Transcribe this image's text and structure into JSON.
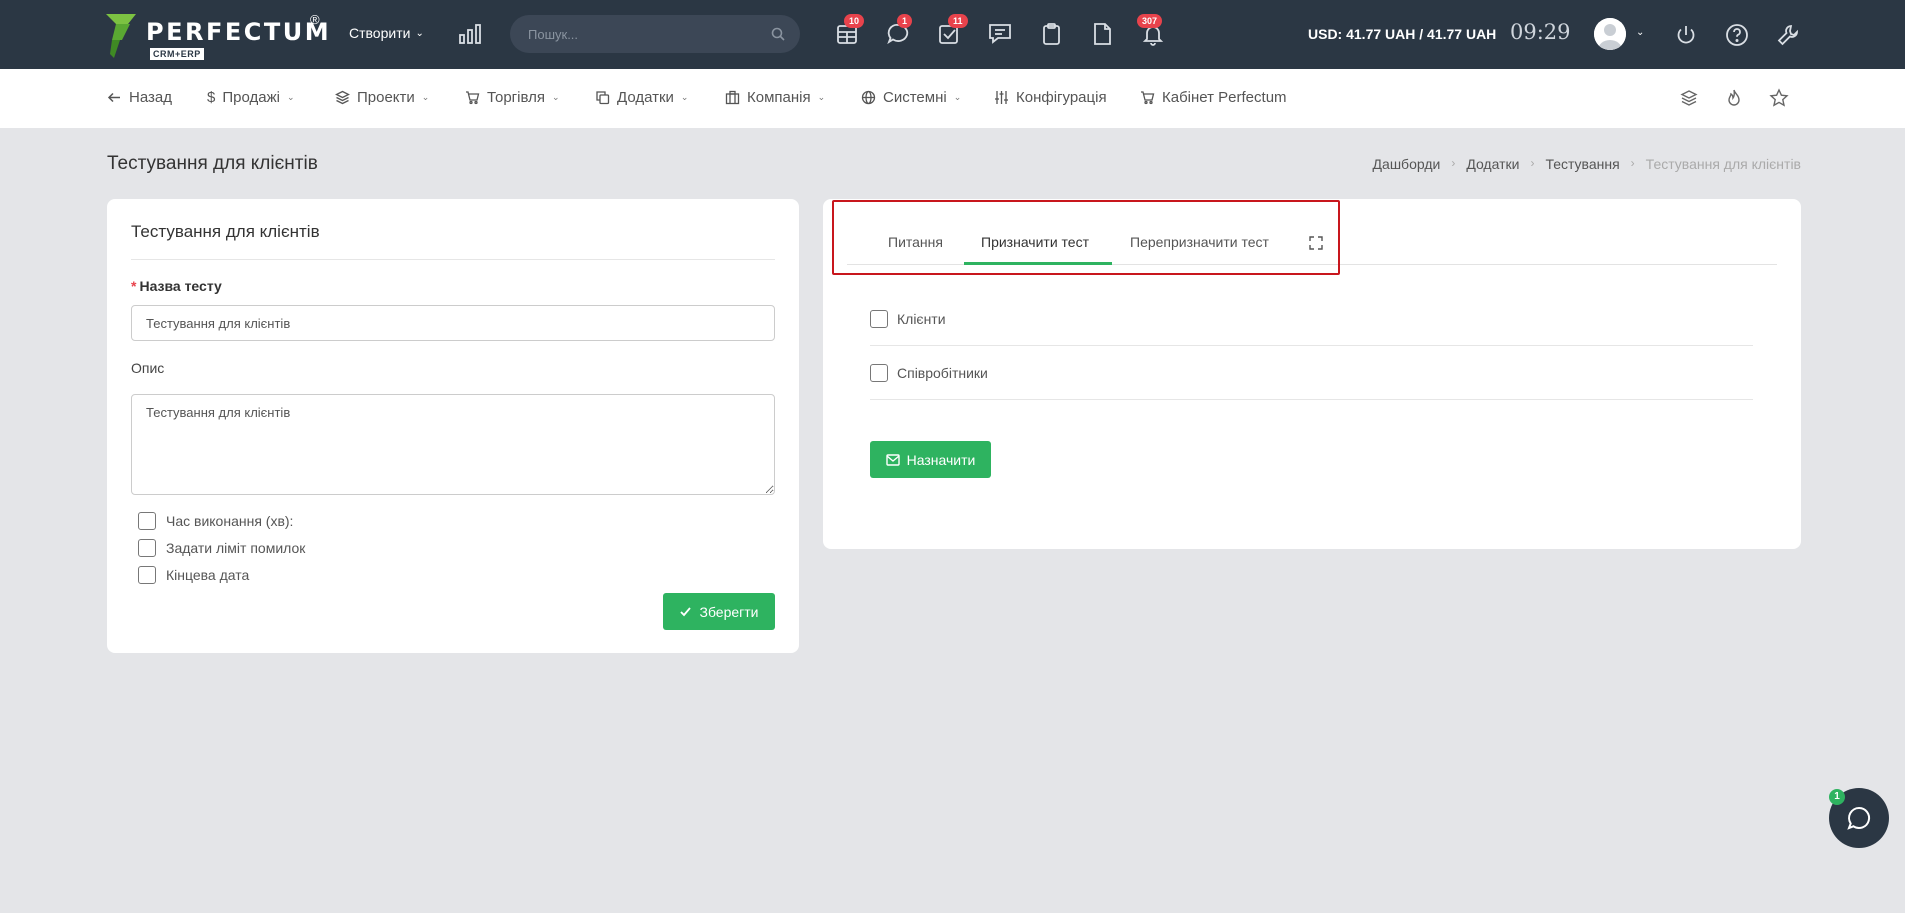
{
  "brand": {
    "name": "PERFECTUM",
    "reg": "®",
    "sub": "CRM+ERP"
  },
  "topbar": {
    "create_label": "Створити",
    "search_placeholder": "Пошук...",
    "badges": {
      "tasks": "10",
      "chat": "1",
      "checklist": "11",
      "notifications": "307"
    },
    "currency": "USD: 41.77 UAH / 41.77 UAH",
    "time": "09:29"
  },
  "nav": {
    "back": "Назад",
    "sales": "Продажі",
    "projects": "Проекти",
    "trade": "Торгівля",
    "addons": "Додатки",
    "company": "Компанія",
    "system": "Системні",
    "config": "Конфігурація",
    "cabinet": "Кабінет Perfectum"
  },
  "page": {
    "title": "Тестування для клієнтів"
  },
  "breadcrumb": [
    "Дашборди",
    "Додатки",
    "Тестування",
    "Тестування для клієнтів"
  ],
  "form": {
    "title": "Тестування для клієнтів",
    "name_label": "Назва тесту",
    "name_value": "Тестування для клієнтів",
    "desc_label": "Опис",
    "desc_value": "Тестування для клієнтів",
    "options": [
      "Час виконання (хв):",
      "Задати ліміт помилок",
      "Кінцева дата"
    ],
    "save_label": "Зберегти"
  },
  "tabs": [
    "Питання",
    "Призначити тест",
    "Перепризначити тест"
  ],
  "assign": {
    "options": [
      "Клієнти",
      "Співробітники"
    ],
    "button_label": "Назначити"
  },
  "chat": {
    "badge": "1"
  },
  "colors": {
    "topbar": "#2b3744",
    "accent": "#2eb360",
    "badge": "#e8434c",
    "highlight": "#c8161d"
  }
}
